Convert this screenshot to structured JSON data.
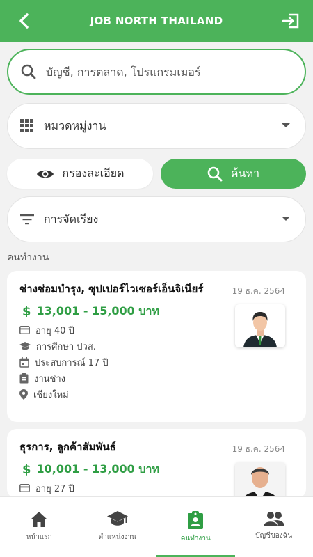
{
  "header": {
    "title": "JOB NORTH THAILAND",
    "back_icon": "chevron-left-icon",
    "logout_icon": "logout-icon"
  },
  "search": {
    "placeholder": "บัญชี, การตลาด, โปรแกรมเมอร์"
  },
  "category": {
    "label": "หมวดหมู่งาน"
  },
  "filter_button": {
    "label": "กรองละเอียด"
  },
  "search_button": {
    "label": "ค้นหา"
  },
  "sort": {
    "label": "การจัดเรียง"
  },
  "section": {
    "label": "คนทำงาน"
  },
  "candidates": [
    {
      "title": "ช่างซ่อมบำรุง, ซุปเปอร์ไวเซอร์เอ็นจิเนียร์",
      "date": "19 ธ.ค. 2564",
      "salary": "13,001 - 15,000 บาท",
      "age": "อายุ 40 ปี",
      "education": "การศึกษา ปวส.",
      "experience": "ประสบการณ์ 17 ปี",
      "field": "งานช่าง",
      "location": "เชียงใหม่"
    },
    {
      "title": "ธุรการ, ลูกค้าสัมพันธ์",
      "date": "19 ธ.ค. 2564",
      "salary": "10,001 - 13,000 บาท",
      "age": "อายุ 27 ปี"
    }
  ],
  "currency_symbol": "$",
  "nav": [
    {
      "label": "หน้าแรก",
      "icon": "home-icon"
    },
    {
      "label": "ตำแหน่งงาน",
      "icon": "graduation-cap-icon"
    },
    {
      "label": "คนทำงาน",
      "icon": "clipboard-person-icon",
      "active": true
    },
    {
      "label": "บัญชีของฉัน",
      "icon": "people-icon"
    }
  ],
  "colors": {
    "primary": "#4cb35a",
    "salary": "#2f9e44",
    "background": "#f2f2f2"
  }
}
